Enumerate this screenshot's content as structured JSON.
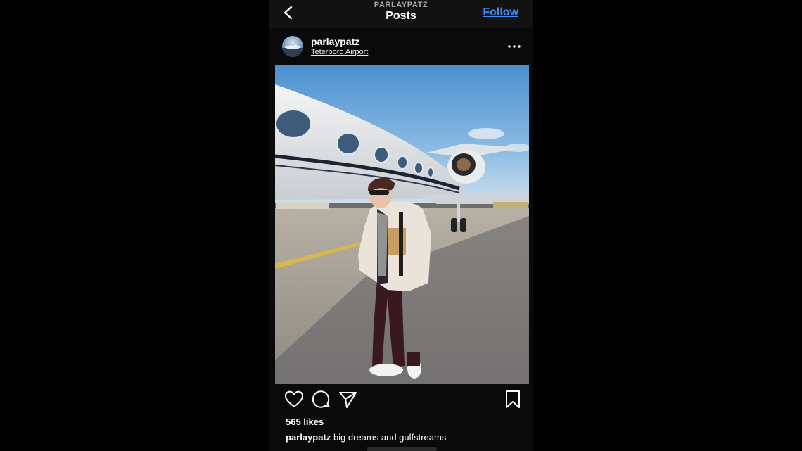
{
  "header": {
    "account_caps": "PARLAYPATZ",
    "title": "Posts",
    "follow_label": "Follow"
  },
  "post": {
    "username": "parlaypatz",
    "location": "Teterboro Airport",
    "likes": "565 likes",
    "caption_user": "parlaypatz",
    "caption_text": "big dreams and gulfstreams",
    "image_alt": "Person in sunglasses and fleece jacket standing beside a private jet on the tarmac"
  },
  "icons": {
    "back": "chevron-left-icon",
    "more": "ellipsis-icon",
    "like": "heart-icon",
    "comment": "comment-bubble-icon",
    "share": "paper-plane-icon",
    "save": "bookmark-icon"
  },
  "colors": {
    "background": "#000000",
    "app_background": "#0a0a0a",
    "follow_blue": "#3e8df0",
    "text": "#ffffff"
  }
}
